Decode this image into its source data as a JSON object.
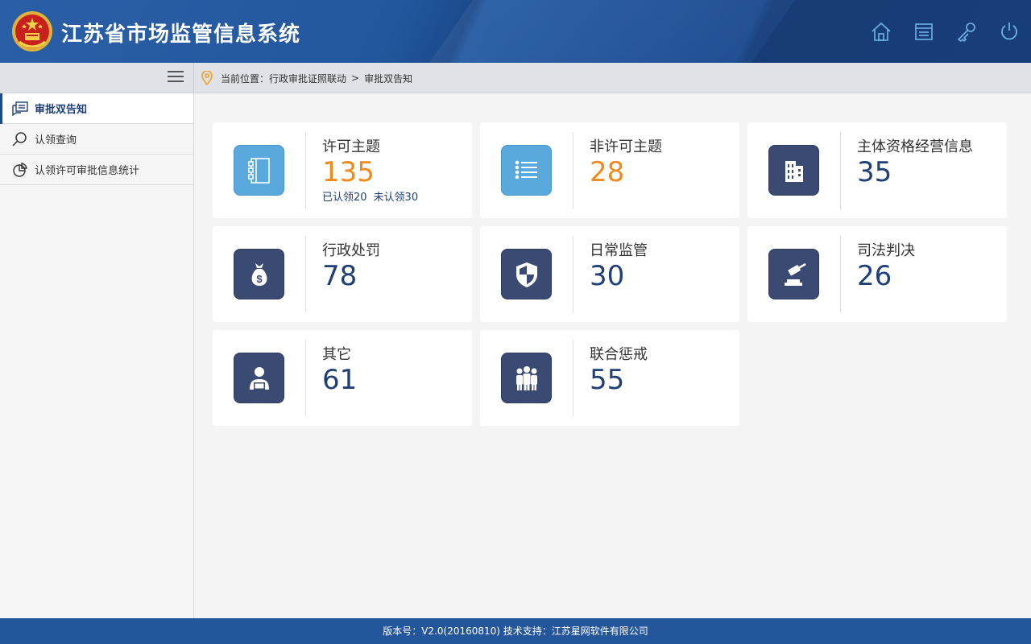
{
  "header": {
    "title": "江苏省市场监管信息系统",
    "icons": [
      "home-icon",
      "window-icon",
      "key-icon",
      "power-icon"
    ]
  },
  "breadcrumb": {
    "prefix": "当前位置：",
    "path": [
      "行政审批证照联动",
      "审批双告知"
    ],
    "separator": ">"
  },
  "sidebar": {
    "items": [
      {
        "label": "审批双告知",
        "icon": "document-icon",
        "active": true
      },
      {
        "label": "认领查询",
        "icon": "search-icon",
        "active": false
      },
      {
        "label": "认领许可审批信息统计",
        "icon": "pie-chart-icon",
        "active": false
      }
    ]
  },
  "cards": [
    {
      "label": "许可主题",
      "value": "135",
      "sub1": "已认领20",
      "sub2": "未认领30",
      "icon": "document-list-icon",
      "color": "#f08a1c"
    },
    {
      "label": "非许可主题",
      "value": "28",
      "icon": "list-icon",
      "color": "#f08a1c"
    },
    {
      "label": "主体资格经营信息",
      "value": "35",
      "icon": "building-icon",
      "color": "#1e3f77"
    },
    {
      "label": "行政处罚",
      "value": "78",
      "icon": "money-bag-icon",
      "color": "#1e3f77"
    },
    {
      "label": "日常监管",
      "value": "30",
      "icon": "shield-icon",
      "color": "#1e3f77"
    },
    {
      "label": "司法判决",
      "value": "26",
      "icon": "gavel-icon",
      "color": "#1e3f77"
    },
    {
      "label": "其它",
      "value": "61",
      "icon": "person-icon",
      "color": "#1e3f77"
    },
    {
      "label": "联合惩戒",
      "value": "55",
      "icon": "group-icon",
      "color": "#1e3f77"
    }
  ],
  "footer": {
    "text": "版本号：V2.0(20160810)  技术支持：江苏星网软件有限公司"
  }
}
